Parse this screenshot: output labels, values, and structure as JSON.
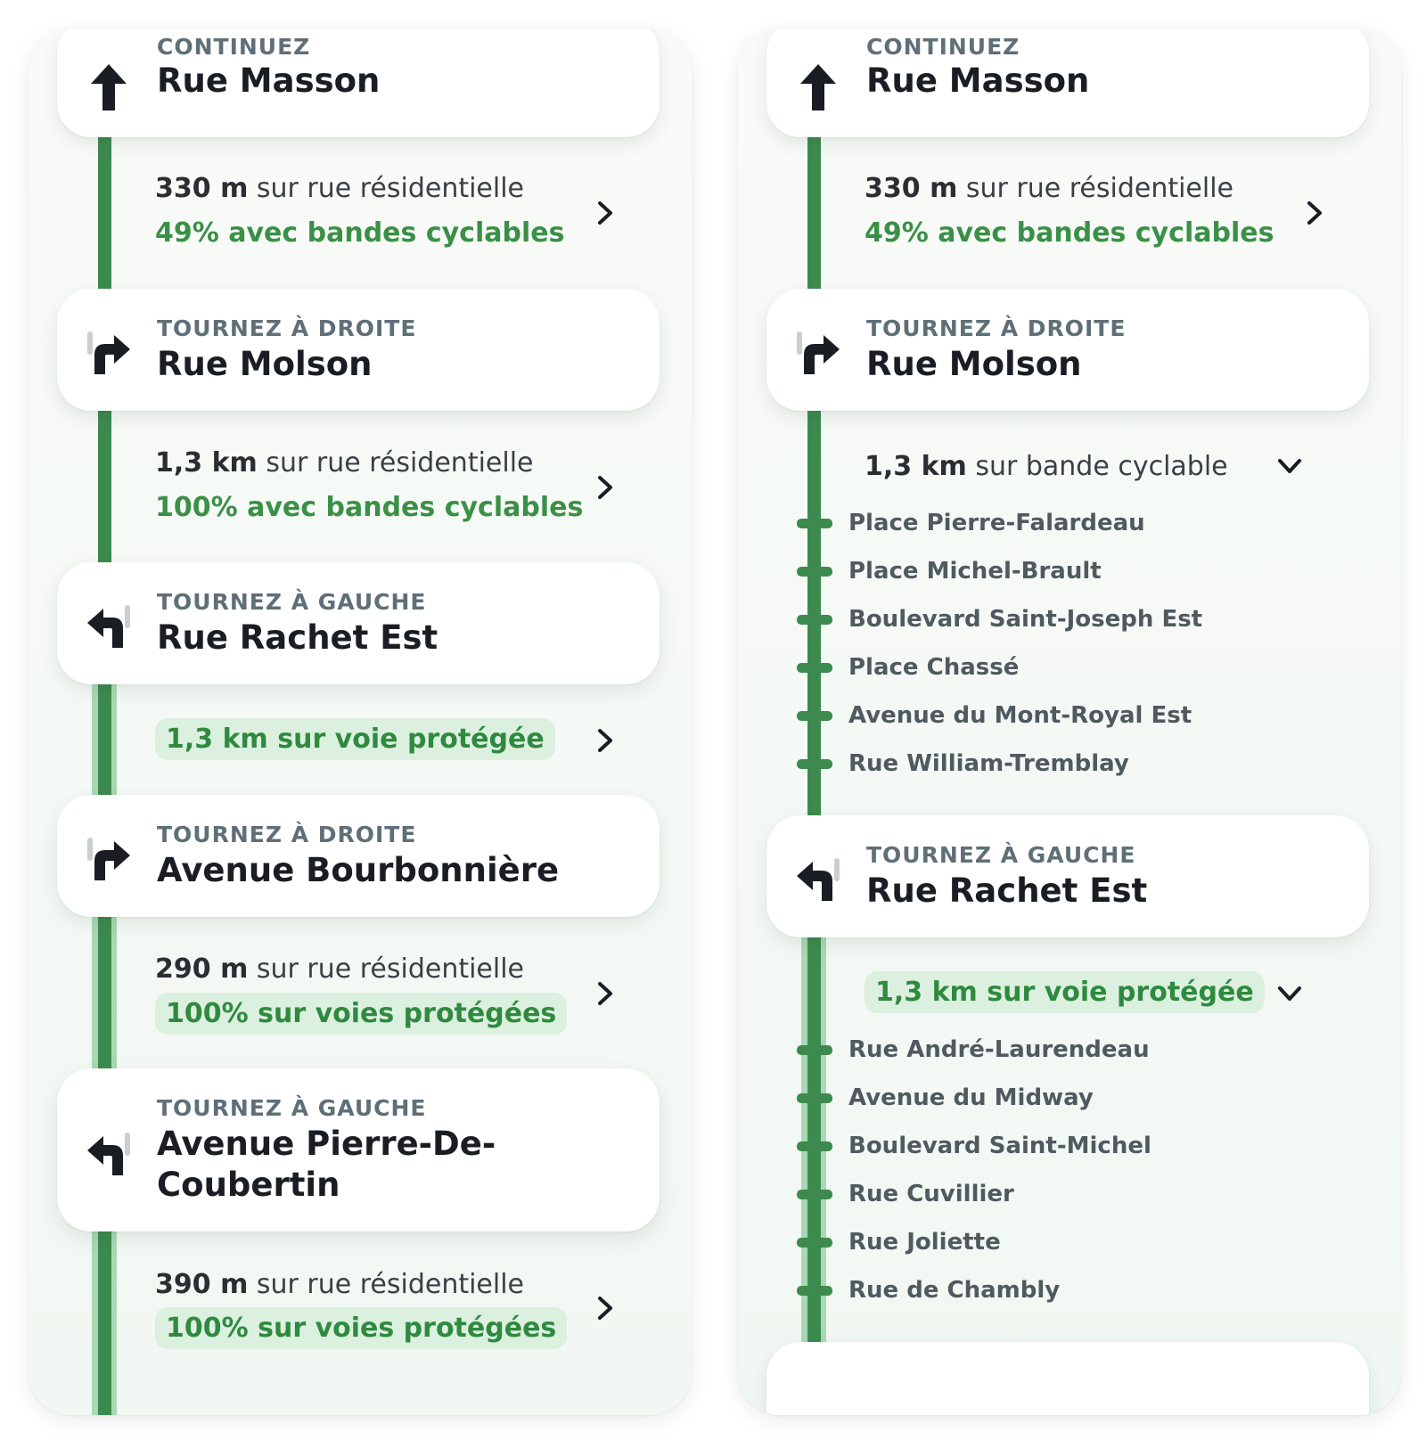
{
  "left": {
    "step1": {
      "tag": "CONTINUEZ",
      "street": "Rue Masson"
    },
    "seg1": {
      "dist": "330 m",
      "rest": " sur rue résidentielle",
      "detail": "49% avec bandes cyclables"
    },
    "step2": {
      "tag": "TOURNEZ À DROITE",
      "street": "Rue Molson"
    },
    "seg2": {
      "dist": "1,3 km",
      "rest": " sur rue résidentielle",
      "detail": "100% avec bandes cyclables"
    },
    "step3": {
      "tag": "TOURNEZ À GAUCHE",
      "street": "Rue Rachet Est"
    },
    "seg3": {
      "pill": "1,3 km sur voie protégée"
    },
    "step4": {
      "tag": "TOURNEZ À DROITE",
      "street": "Avenue Bourbonnière"
    },
    "seg4": {
      "dist": "290 m",
      "rest": " sur rue résidentielle",
      "pill": "100% sur voies protégées"
    },
    "step5": {
      "tag": "TOURNEZ À GAUCHE",
      "street": "Avenue Pierre-De-Coubertin"
    },
    "seg5": {
      "dist": "390 m",
      "rest": " sur rue résidentielle",
      "pill": "100% sur voies protégées"
    }
  },
  "right": {
    "step1": {
      "tag": "CONTINUEZ",
      "street": "Rue Masson"
    },
    "seg1": {
      "dist": "330 m",
      "rest": " sur rue résidentielle",
      "detail": "49% avec bandes cyclables"
    },
    "step2": {
      "tag": "TOURNEZ À DROITE",
      "street": "Rue Molson"
    },
    "seg2": {
      "dist": "1,3 km",
      "rest": " sur bande cyclable",
      "streets": [
        "Place Pierre-Falardeau",
        "Place Michel-Brault",
        "Boulevard Saint-Joseph Est",
        "Place Chassé",
        "Avenue du Mont-Royal Est",
        "Rue William-Tremblay"
      ]
    },
    "step3": {
      "tag": "TOURNEZ À GAUCHE",
      "street": "Rue Rachet Est"
    },
    "seg3": {
      "pill": "1,3 km sur voie protégée",
      "streets": [
        "Rue André-Laurendeau",
        "Avenue du Midway",
        "Boulevard Saint-Michel",
        "Rue Cuvillier",
        "Rue Joliette",
        "Rue de Chambly"
      ]
    }
  },
  "colors": {
    "route_green": "#3d8a4f",
    "protected_light": "#a9d8b4",
    "pill_bg": "#dcf0e0",
    "accent_text": "#3a9046"
  }
}
